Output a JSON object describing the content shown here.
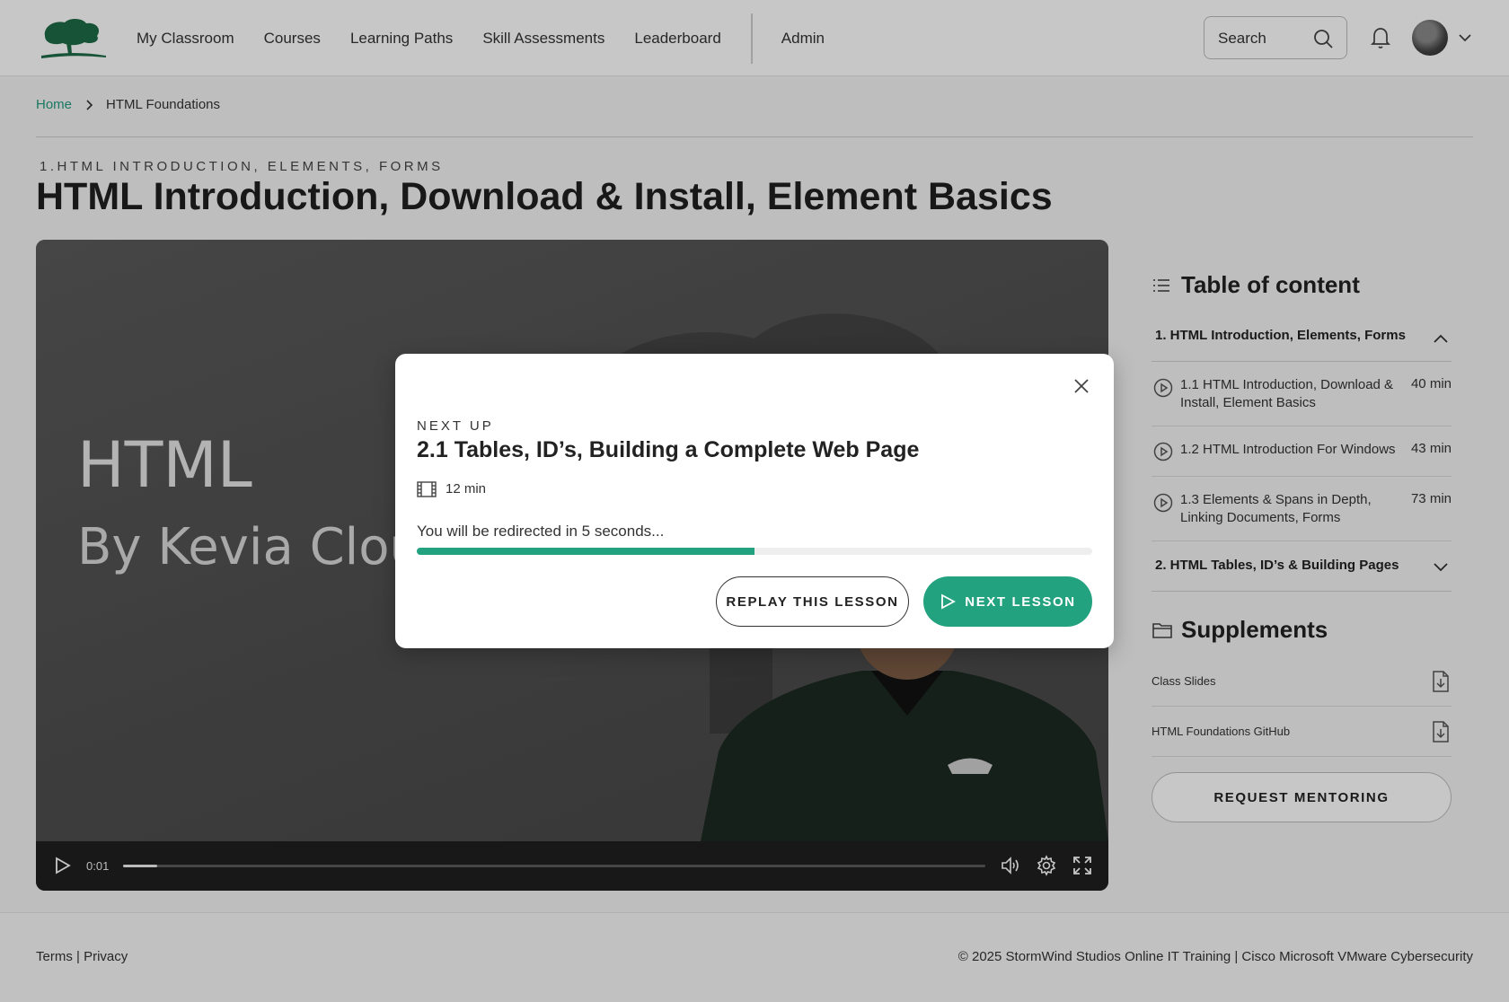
{
  "header": {
    "nav": [
      "My Classroom",
      "Courses",
      "Learning Paths",
      "Skill Assessments",
      "Leaderboard"
    ],
    "admin": "Admin",
    "search_label": "Search"
  },
  "breadcrumb": {
    "home": "Home",
    "current": "HTML Foundations"
  },
  "page": {
    "eyebrow": "1.HTML INTRODUCTION, ELEMENTS, FORMS",
    "title": "HTML Introduction, Download & Install, Element Basics"
  },
  "video": {
    "line1": "HTML",
    "line2": "By Kevia Cloud",
    "time": "0:01",
    "progress": 0.04
  },
  "modal": {
    "eyebrow": "NEXT UP",
    "title": "2.1 Tables, ID’s, Building a Complete Web Page",
    "duration": "12 min",
    "redirect": "You will be redirected in 5 seconds...",
    "progress": 0.5,
    "replay_label": "REPLAY THIS LESSON",
    "next_label": "NEXT LESSON"
  },
  "toc": {
    "title": "Table of content",
    "section1": "1. HTML Introduction, Elements, Forms",
    "lessons": [
      {
        "title": "1.1 HTML Introduction, Download & Install, Element Basics",
        "duration": "40 min"
      },
      {
        "title": "1.2 HTML Introduction For Windows",
        "duration": "43 min"
      },
      {
        "title": "1.3 Elements & Spans in Depth, Linking Documents, Forms",
        "duration": "73 min"
      }
    ],
    "section2": "2. HTML Tables, ID’s & Building Pages"
  },
  "supplements": {
    "title": "Supplements",
    "items": [
      "Class Slides",
      "HTML Foundations GitHub"
    ]
  },
  "mentoring_label": "REQUEST MENTORING",
  "footer": {
    "terms": "Terms",
    "privacy": "Privacy",
    "copyright": "© 2025 StormWind Studios Online IT Training | Cisco Microsoft VMware Cybersecurity"
  },
  "colors": {
    "accent": "#23a27f",
    "brand_logo": "#1e6b46"
  }
}
